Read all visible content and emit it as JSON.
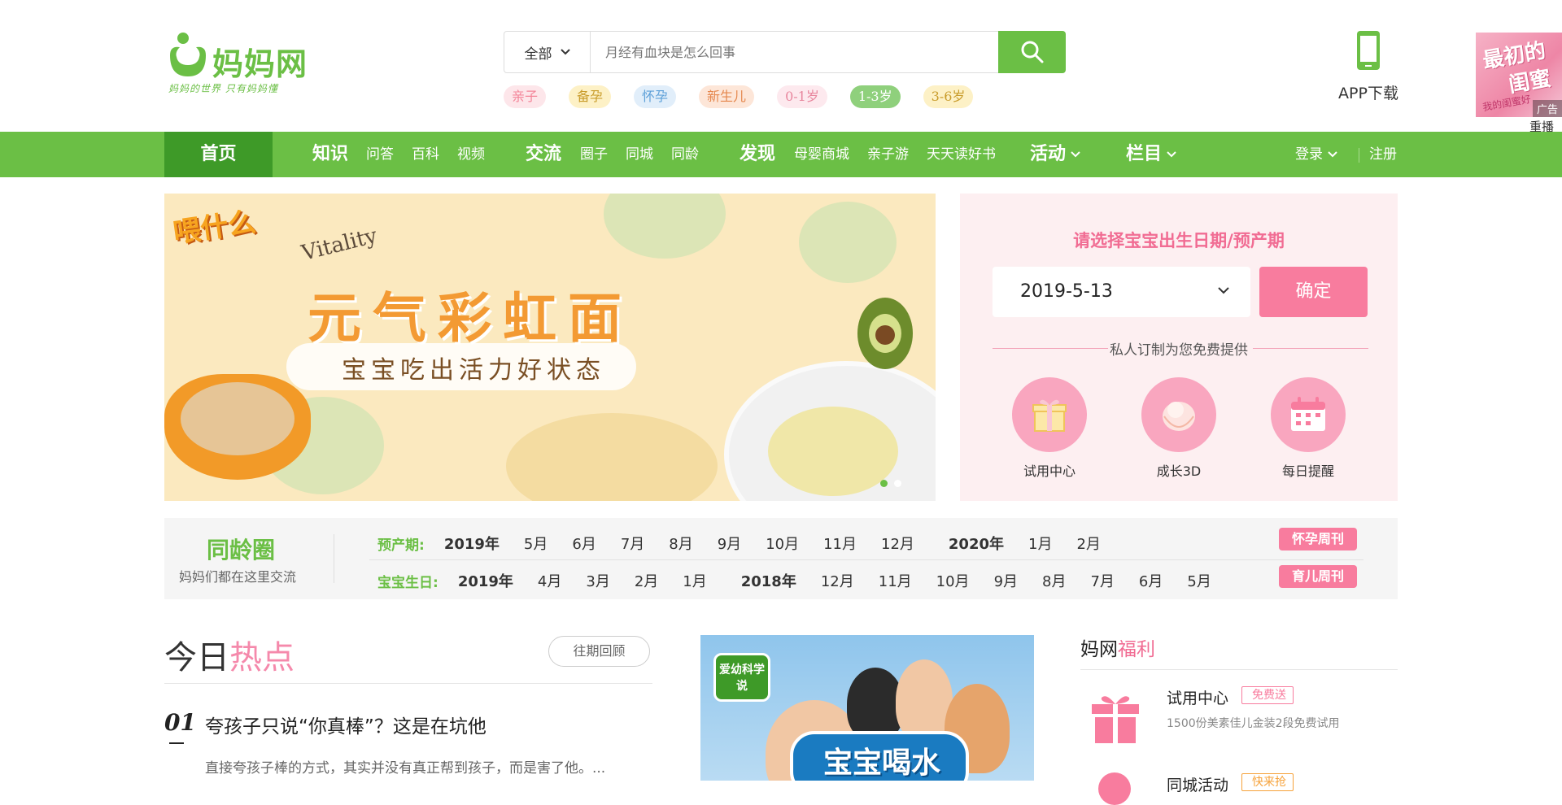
{
  "logo": {
    "text": "妈妈网",
    "slogan": "妈妈的世界 只有妈妈懂"
  },
  "search": {
    "category": "全部",
    "placeholder": "月经有血块是怎么回事"
  },
  "tags": [
    {
      "label": "亲子",
      "color": "#f4869a",
      "bg": "#fde6ea"
    },
    {
      "label": "备孕",
      "color": "#c99c2b",
      "bg": "#fdf1c6"
    },
    {
      "label": "怀孕",
      "color": "#5b9fd8",
      "bg": "#e1eefa"
    },
    {
      "label": "新生儿",
      "color": "#e5874d",
      "bg": "#fde6d8"
    },
    {
      "label": "0-1岁",
      "color": "#e8879e",
      "bg": "#fde9ee"
    },
    {
      "label": "1-3岁",
      "color": "#ffffff",
      "bg": "#8fd07c"
    },
    {
      "label": "3-6岁",
      "color": "#c99c2b",
      "bg": "#fdf1c6"
    }
  ],
  "app_download": {
    "label": "APP下载"
  },
  "ad": {
    "line1": "最初的",
    "line2": "闺蜜",
    "line3": "我的闺蜜好",
    "badge": "广告",
    "replay": "重播"
  },
  "nav": {
    "home": "首页",
    "groups": [
      {
        "main": "知识",
        "subs": [
          "问答",
          "百科",
          "视频"
        ]
      },
      {
        "main": "交流",
        "subs": [
          "圈子",
          "同城",
          "同龄"
        ]
      },
      {
        "main": "发现",
        "subs": [
          "母婴商城",
          "亲子游",
          "天天读好书"
        ]
      }
    ],
    "activity": "活动",
    "column": "栏目",
    "login": "登录",
    "register": "注册"
  },
  "banner": {
    "brand": "喂什么",
    "vitality": "Vitality",
    "title": "元气彩虹面",
    "subtitle": "宝宝吃出活力好状态",
    "slide_count": 2,
    "active_slide": 0
  },
  "birth_panel": {
    "heading": "请选择宝宝出生日期/预产期",
    "date_value": "2019-5-13",
    "confirm": "确定",
    "subheading": "私人订制为您免费提供",
    "features": [
      {
        "label": "试用中心",
        "icon": "gift-icon"
      },
      {
        "label": "成长3D",
        "icon": "baby-icon"
      },
      {
        "label": "每日提醒",
        "icon": "calendar-icon"
      }
    ]
  },
  "peer": {
    "title": "同龄圈",
    "subtitle": "妈妈们都在这里交流",
    "rows": [
      {
        "label": "预产期:",
        "items": [
          {
            "t": "2019年",
            "year": true
          },
          {
            "t": "5月"
          },
          {
            "t": "6月"
          },
          {
            "t": "7月"
          },
          {
            "t": "8月"
          },
          {
            "t": "9月"
          },
          {
            "t": "10月"
          },
          {
            "t": "11月"
          },
          {
            "t": "12月"
          },
          {
            "t": "2020年",
            "year": true
          },
          {
            "t": "1月"
          },
          {
            "t": "2月"
          }
        ],
        "badge": "怀孕周刊"
      },
      {
        "label": "宝宝生日:",
        "items": [
          {
            "t": "2019年",
            "year": true
          },
          {
            "t": "4月"
          },
          {
            "t": "3月"
          },
          {
            "t": "2月"
          },
          {
            "t": "1月"
          },
          {
            "t": "2018年",
            "year": true
          },
          {
            "t": "12月"
          },
          {
            "t": "11月"
          },
          {
            "t": "10月"
          },
          {
            "t": "9月"
          },
          {
            "t": "8月"
          },
          {
            "t": "7月"
          },
          {
            "t": "6月"
          },
          {
            "t": "5月"
          }
        ],
        "badge": "育儿周刊"
      }
    ]
  },
  "hot": {
    "title_a": "今日",
    "title_b": "热点",
    "past": "往期回顾",
    "item": {
      "num": "01",
      "headline": "夸孩子只说“你真棒”？这是在坑他",
      "desc": "直接夸孩子棒的方式，其实并没有真正帮到孩子，而是害了他。..."
    }
  },
  "video": {
    "badge": "爱幼科学说",
    "title": "宝宝喝水"
  },
  "welfare": {
    "title_a": "妈网",
    "title_b": "福利",
    "items": [
      {
        "name": "试用中心",
        "tag": "免费送",
        "desc": "1500份美素佳儿金装2段免费试用"
      },
      {
        "name": "同城活动",
        "tag": "快来抢"
      }
    ]
  },
  "colors": {
    "brand_green": "#6bbf45",
    "nav_active": "#3e9a28",
    "pink": "#f87c9e"
  }
}
